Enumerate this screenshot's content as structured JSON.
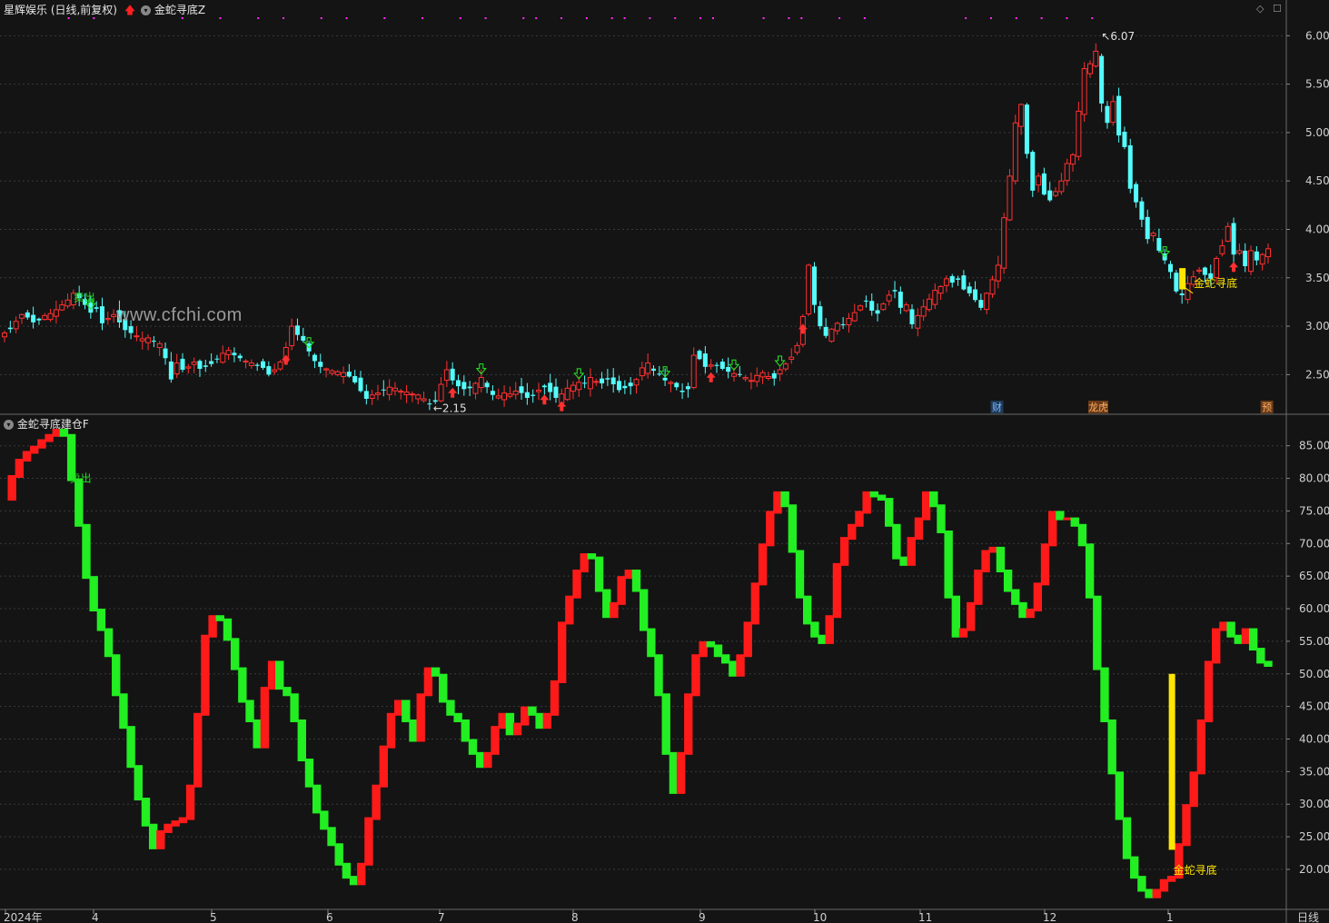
{
  "window": {
    "stock_title": "星辉娱乐 (日线,前复权)",
    "upper_indicator_name": "金蛇寻底Z",
    "lower_indicator_name": "金蛇寻底建仓F",
    "period_label": "日线",
    "watermark": "www.cfchi.com"
  },
  "colors": {
    "background": "#141414",
    "up": "#ff3030",
    "down": "#54fcfc",
    "ind_up": "#ff1a1a",
    "ind_down": "#22ee22",
    "signal_yellow": "#ffe600",
    "magenta_dots": "#ff2bff",
    "sell_label": "#22dd22",
    "arrow_down_outline": "#22ee22"
  },
  "icons": {
    "collapse_toggle": "chevron-down-icon",
    "buy_signal": "red-up-arrow-icon",
    "sell_signal": "green-down-arrow-icon",
    "panel_diamond": "diamond-icon",
    "panel_maximize": "square-icon"
  },
  "chart_data": [
    {
      "type": "candlestick",
      "title": "星辉娱乐 (日线,前复权)",
      "y_ticks": [
        "6.00",
        "5.50",
        "5.00",
        "4.50",
        "4.00",
        "3.50",
        "3.00",
        "2.50"
      ],
      "ylim": [
        2.1,
        6.2
      ],
      "annotations": {
        "max_label": "6.07",
        "min_label": "2.15",
        "signal_label": "金蛇寻底",
        "sell_label": "卖出",
        "event_badges": [
          "财",
          "龙虎",
          "预"
        ]
      },
      "close_series": [
        2.93,
        2.97,
        3.05,
        3.12,
        3.09,
        3.04,
        3.06,
        3.11,
        3.13,
        3.17,
        3.22,
        3.27,
        3.34,
        3.29,
        3.22,
        3.14,
        3.18,
        3.03,
        3.08,
        3.12,
        3.04,
        2.96,
        2.93,
        2.9,
        2.87,
        2.88,
        2.84,
        2.82,
        2.67,
        2.45,
        2.62,
        2.55,
        2.58,
        2.63,
        2.56,
        2.58,
        2.61,
        2.66,
        2.72,
        2.75,
        2.7,
        2.67,
        2.64,
        2.62,
        2.59,
        2.57,
        2.5,
        2.55,
        2.63,
        2.78,
        3.0,
        2.91,
        2.85,
        2.74,
        2.64,
        2.58,
        2.56,
        2.54,
        2.53,
        2.52,
        2.48,
        2.42,
        2.33,
        2.25,
        2.29,
        2.31,
        2.34,
        2.37,
        2.36,
        2.33,
        2.32,
        2.3,
        2.29,
        2.25,
        2.2,
        2.22,
        2.4,
        2.55,
        2.44,
        2.38,
        2.35,
        2.36,
        2.41,
        2.47,
        2.37,
        2.29,
        2.28,
        2.31,
        2.3,
        2.33,
        2.31,
        2.26,
        2.28,
        2.34,
        2.37,
        2.32,
        2.26,
        2.3,
        2.36,
        2.39,
        2.42,
        2.41,
        2.47,
        2.43,
        2.41,
        2.45,
        2.4,
        2.34,
        2.36,
        2.38,
        2.45,
        2.57,
        2.62,
        2.54,
        2.5,
        2.44,
        2.42,
        2.37,
        2.32,
        2.35,
        2.7,
        2.66,
        2.58,
        2.6,
        2.59,
        2.56,
        2.53,
        2.51,
        2.5,
        2.47,
        2.44,
        2.49,
        2.52,
        2.48,
        2.46,
        2.55,
        2.61,
        2.68,
        2.8,
        3.1,
        3.63,
        3.22,
        3.0,
        2.9,
        2.97,
        3.03,
        3.02,
        3.08,
        3.14,
        3.21,
        3.26,
        3.16,
        3.13,
        3.23,
        3.32,
        3.36,
        3.19,
        3.22,
        3.02,
        3.11,
        3.2,
        3.28,
        3.37,
        3.41,
        3.49,
        3.45,
        3.48,
        3.38,
        3.34,
        3.27,
        3.19,
        3.34,
        3.48,
        3.63,
        4.12,
        4.55,
        5.1,
        5.29,
        4.78,
        4.4,
        4.55,
        4.36,
        4.3,
        4.39,
        4.5,
        4.68,
        4.77,
        5.22,
        5.66,
        5.71,
        5.84,
        5.3,
        5.1,
        5.32,
        4.97,
        4.85,
        4.42,
        4.28,
        4.1,
        3.9,
        3.96,
        3.78,
        3.68,
        3.56,
        3.36,
        3.32,
        3.44,
        3.51,
        3.58,
        3.53,
        3.49,
        3.7,
        3.83,
        4.03,
        3.74,
        3.78,
        3.62,
        3.78,
        3.68,
        3.74,
        3.8
      ]
    },
    {
      "type": "line",
      "title": "金蛇寻底建仓F",
      "y_ticks": [
        "85.00",
        "80.00",
        "75.00",
        "70.00",
        "65.00",
        "60.00",
        "55.00",
        "50.00",
        "45.00",
        "40.00",
        "35.00",
        "30.00",
        "25.00",
        "20.00"
      ],
      "ylim": [
        14,
        89
      ],
      "x_ticks": [
        "2024年",
        "4",
        "5",
        "6",
        "7",
        "8",
        "9",
        "10",
        "11",
        "12",
        "1"
      ],
      "annotations": {
        "signal_label": "金蛇寻底",
        "sell_label": "卖出"
      },
      "values": [
        77.0,
        80.5,
        83.0,
        84.2,
        85.0,
        86.0,
        86.8,
        87.6,
        86.8,
        80.0,
        73.0,
        65.0,
        60.0,
        57.0,
        53.0,
        47.0,
        42.0,
        36.0,
        31.0,
        27.0,
        23.5,
        26.0,
        27.0,
        27.5,
        28.0,
        33.0,
        44.0,
        56.0,
        59.0,
        58.5,
        55.5,
        51.0,
        46.0,
        43.0,
        39.0,
        48.0,
        52.0,
        48.0,
        47.0,
        43.0,
        37.0,
        33.0,
        29.0,
        26.5,
        24.0,
        21.0,
        19.0,
        18.0,
        21.0,
        28.0,
        33.0,
        39.0,
        44.0,
        46.0,
        43.0,
        40.0,
        47.0,
        51.0,
        50.0,
        46.0,
        44.0,
        43.0,
        40.0,
        38.0,
        36.0,
        38.0,
        42.0,
        44.0,
        41.0,
        42.5,
        45.0,
        44.0,
        42.0,
        44.0,
        49.0,
        58.0,
        62.0,
        66.0,
        68.5,
        68.0,
        63.0,
        59.0,
        61.0,
        65.0,
        66.0,
        63.0,
        57.0,
        53.0,
        47.0,
        38.0,
        32.0,
        38.0,
        47.0,
        53.0,
        55.0,
        54.5,
        53.0,
        52.0,
        50.0,
        53.0,
        58.0,
        64.0,
        70.0,
        75.0,
        78.0,
        76.0,
        69.0,
        62.0,
        58.0,
        56.0,
        55.0,
        59.0,
        67.0,
        71.0,
        73.0,
        75.0,
        78.0,
        77.5,
        77.0,
        73.0,
        68.0,
        67.0,
        71.0,
        74.0,
        78.0,
        76.0,
        72.0,
        62.0,
        56.0,
        57.0,
        61.0,
        66.0,
        69.0,
        69.5,
        66.0,
        63.0,
        61.0,
        59.0,
        60.0,
        64.0,
        70.0,
        75.0,
        74.0,
        74.0,
        73.0,
        70.0,
        62.0,
        51.0,
        43.0,
        35.0,
        28.0,
        22.0,
        19.0,
        17.0,
        16.0,
        17.0,
        18.5,
        19.0,
        24.0,
        30.0,
        35.0,
        43.0,
        52.0,
        57.0,
        58.0,
        56.0,
        55.0,
        57.0,
        54.0,
        52.0,
        51.5
      ],
      "yellow_bar": {
        "from": 23.0,
        "to": 50.0
      }
    }
  ]
}
